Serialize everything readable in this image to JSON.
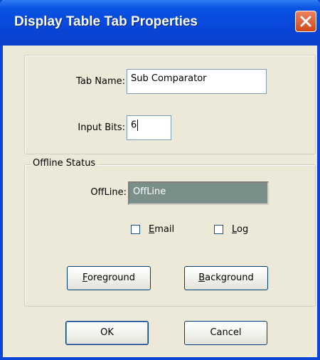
{
  "window": {
    "title": "Display Table Tab Properties"
  },
  "form": {
    "tab_name_label": "Tab Name:",
    "tab_name_value": "Sub Comparator",
    "input_bits_label": "Input Bits:",
    "input_bits_value": "6"
  },
  "offline": {
    "group_label": "Offline Status",
    "offline_label": "OffLine:",
    "offline_value": "OffLine",
    "email": {
      "accel": "E",
      "rest": "mail",
      "checked": false
    },
    "log": {
      "accel": "L",
      "rest": "og",
      "checked": false
    },
    "foreground": {
      "accel": "F",
      "rest": "oreground"
    },
    "background": {
      "accel": "B",
      "rest": "ackground"
    }
  },
  "buttons": {
    "ok": "OK",
    "cancel": "Cancel"
  }
}
